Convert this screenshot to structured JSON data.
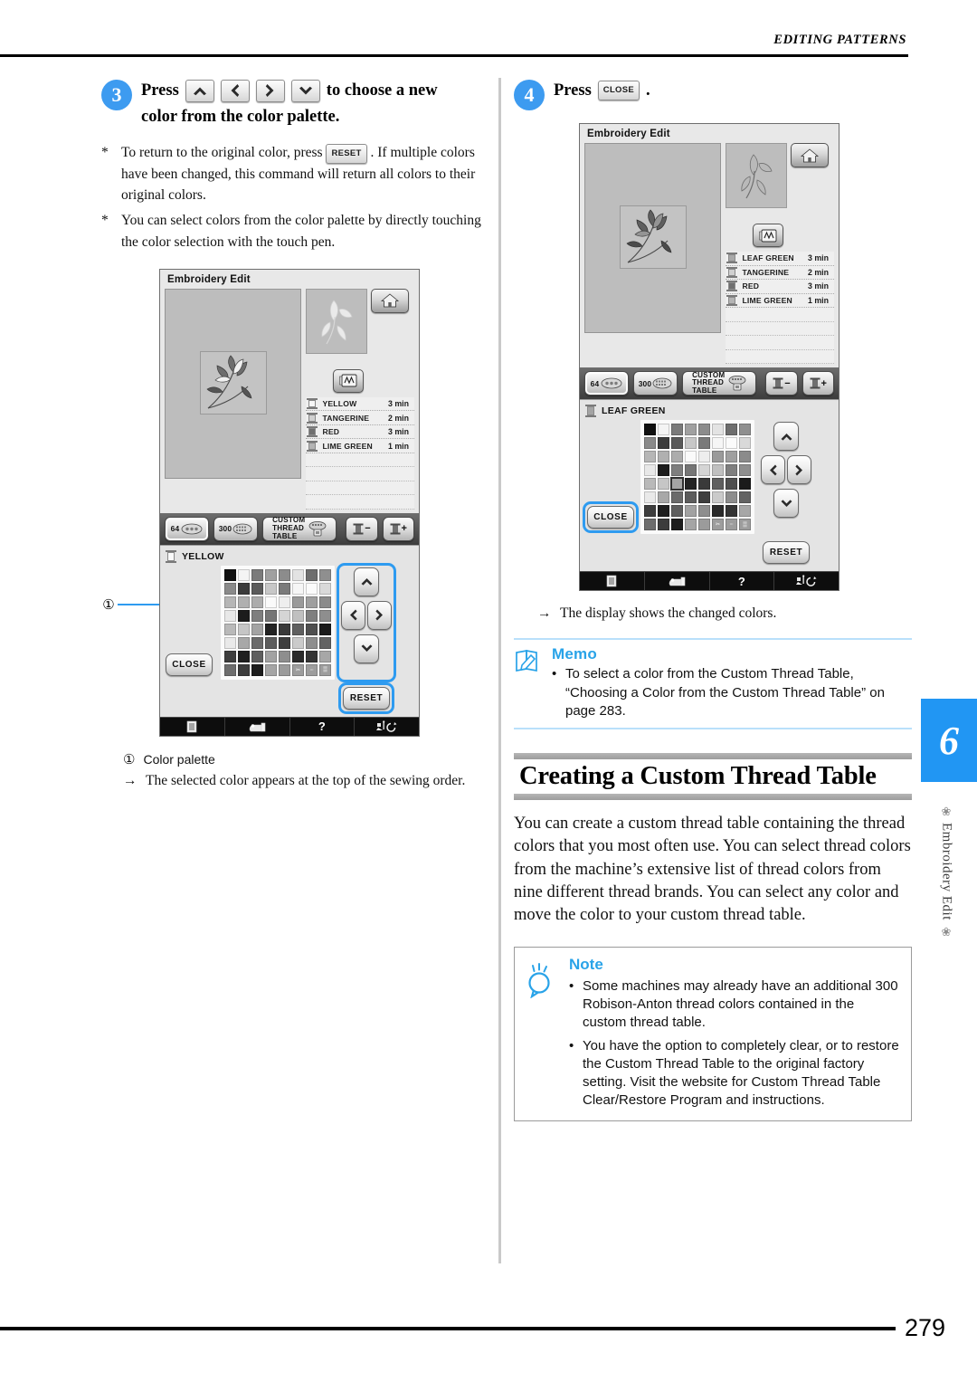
{
  "page": {
    "running_head": "EDITING PATTERNS",
    "folio": "279",
    "chapter_number": "6",
    "chapter_name": "Embroidery Edit",
    "ornament": "❀"
  },
  "colors": {
    "accent_blue": "#2196f3",
    "step_badge_blue": "#3d9bf0",
    "memo_heading_blue": "#29a3e8",
    "highlight_blue": "#2e9bf0",
    "lcd_bg": "#e8e8e8",
    "lcd_canvas": "#bdbdbd",
    "band_gray": "#9c9c9c"
  },
  "left_column": {
    "step": {
      "number": "3",
      "text_before": "Press",
      "keys": [
        "up-arrow-key",
        "left-arrow-key",
        "right-arrow-key",
        "down-arrow-key"
      ],
      "text_after": "to choose a new",
      "line2": "color from the color palette."
    },
    "notes": [
      {
        "marker": "*",
        "segments": [
          "To return to the original color, press",
          "RESET",
          ". If multiple colors have been changed, this command will return all colors to their original colors."
        ],
        "inline_key": "RESET"
      },
      {
        "marker": "*",
        "segments": [
          "You can select colors from the color palette by directly touching the color selection with the touch pen."
        ],
        "inline_key": ""
      }
    ],
    "callout": {
      "number": "①",
      "label": "Color palette"
    },
    "result_arrow": "→",
    "result_text": "The selected color appears at the top of the sewing order."
  },
  "right_column": {
    "step": {
      "number": "4",
      "text_before": "Press",
      "key_label": "CLOSE",
      "text_after": "."
    },
    "result_arrow": "→",
    "result_text": "The display shows the changed colors.",
    "memo": {
      "title": "Memo",
      "bullet": "•",
      "items": [
        "To select a color from the Custom Thread Table, “Choosing a Color from the Custom Thread Table” on page 283."
      ]
    },
    "section": {
      "title": "Creating a Custom Thread Table",
      "paragraph": "You can create a custom thread table containing the thread colors that you most often use. You can select thread colors from the machine’s extensive list of thread colors from nine different thread brands. You can select any color and move the color to your custom thread table."
    },
    "note": {
      "title": "Note",
      "bullet": "•",
      "items": [
        "Some machines may already have an additional 300 Robison-Anton thread colors contained in the custom thread table.",
        "You have the option to completely clear, or to restore the Custom Thread Table to the original factory setting. Visit the website for Custom Thread Table Clear/Restore Program and instructions."
      ]
    }
  },
  "lcd_left": {
    "title": "Embroidery Edit",
    "home_icon": "home-icon",
    "needle_icon": "needle-preview-icon",
    "thread_list": [
      {
        "name": "YELLOW",
        "time": "3 min",
        "swatch": "#f7f7f7"
      },
      {
        "name": "TANGERINE",
        "time": "2 min",
        "swatch": "#d0d0d0"
      },
      {
        "name": "RED",
        "time": "3 min",
        "swatch": "#6f6f6f"
      },
      {
        "name": "LIME GREEN",
        "time": "1 min",
        "swatch": "#b4b4b4"
      }
    ],
    "empty_rows": 4,
    "toolbar": {
      "count_64": "64",
      "count_300": "300",
      "custom_thread_table_line1": "CUSTOM",
      "custom_thread_table_line2": "THREAD",
      "custom_thread_table_line3": "TABLE",
      "spool_minus": "−",
      "spool_plus": "+",
      "selected": "64"
    },
    "palette": {
      "selected_color_name": "YELLOW",
      "close_label": "CLOSE",
      "reset_label": "RESET",
      "highlighted": [
        "nav-pad",
        "reset-button"
      ],
      "selected_swatch_index": null
    },
    "bottom_icons": [
      "document-icon",
      "machine-icon",
      "help-icon",
      "needle-rotate-icon"
    ]
  },
  "lcd_right": {
    "title": "Embroidery Edit",
    "home_icon": "home-icon",
    "needle_icon": "needle-preview-icon",
    "thread_list": [
      {
        "name": "LEAF GREEN",
        "time": "3 min",
        "swatch": "#a8a8a8"
      },
      {
        "name": "TANGERINE",
        "time": "2 min",
        "swatch": "#d0d0d0"
      },
      {
        "name": "RED",
        "time": "3 min",
        "swatch": "#6f6f6f"
      },
      {
        "name": "LIME GREEN",
        "time": "1 min",
        "swatch": "#b4b4b4"
      }
    ],
    "empty_rows": 4,
    "toolbar": {
      "count_64": "64",
      "count_300": "300",
      "custom_thread_table_line1": "CUSTOM",
      "custom_thread_table_line2": "THREAD",
      "custom_thread_table_line3": "TABLE",
      "spool_minus": "−",
      "spool_plus": "+",
      "selected": "64"
    },
    "palette": {
      "selected_color_name": "LEAF GREEN",
      "close_label": "CLOSE",
      "reset_label": "RESET",
      "highlighted": [
        "close-button"
      ],
      "selected_swatch_index": 34
    },
    "bottom_icons": [
      "document-icon",
      "machine-icon",
      "help-icon",
      "needle-rotate-icon"
    ]
  },
  "palette_grid": {
    "columns": 8,
    "rows": 8,
    "swatches": [
      "#111111",
      "#f4f4f4",
      "#7b7b7b",
      "#a0a0a0",
      "#8c8c8c",
      "#e3e3e3",
      "#6e6e6e",
      "#8f8f8f",
      "#8a8a8a",
      "#3b3b3b",
      "#5a5a5a",
      "#c7c7c7",
      "#7a7a7a",
      "#f6f6f6",
      "#fbfbfb",
      "#d9d9d9",
      "#b6b6b6",
      "#b0b0b0",
      "#acacac",
      "#fafafa",
      "#eeeeee",
      "#9a9a9a",
      "#9f9f9f",
      "#8b8b8b",
      "#e8e8e8",
      "#1c1c1c",
      "#7e7e7e",
      "#767676",
      "#d5d5d5",
      "#c0c0c0",
      "#7f7f7f",
      "#8e8e8e",
      "#b9b9b9",
      "#c6c6c6",
      "#a4a4a4",
      "#232323",
      "#3a3a3a",
      "#5f5f5f",
      "#4f4f4f",
      "#1b1b1b",
      "#e9e9e9",
      "#a8a8a8",
      "#6b6b6b",
      "#5c5c5c",
      "#3e3e3e",
      "#cacaca",
      "#8d8d8d",
      "#636363",
      "#3d3d3d",
      "#1f1f1f",
      "#5e5e5e",
      "#a2a2a2",
      "#8e8e8e",
      "#2a2a2a",
      "#343434",
      "#a7a7a7",
      "#6d6d6d",
      "#3c3c3c",
      "#1d1d1d",
      "#a5a5a5",
      "#9b9b9b",
      "#9d9d9d",
      "#9d9d9d",
      "#9d9d9d"
    ],
    "icon_cells": [
      61,
      62,
      63
    ],
    "icon_names": [
      "scissors-icon",
      "dashes-icon",
      "pattern-icon"
    ]
  }
}
